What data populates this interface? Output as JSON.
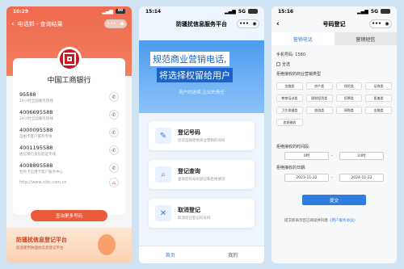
{
  "phone1": {
    "time": "10:29",
    "nav_title": "电话邦 - 查询结果",
    "bank_name": "中国工商银行",
    "numbers": [
      {
        "number": "95588",
        "desc": "24小时全国服务热线"
      },
      {
        "number": "4006695588",
        "desc": "24小时全国服务热线"
      },
      {
        "number": "4000095588",
        "desc": "自由卡客户服务专线"
      },
      {
        "number": "4001195588",
        "desc": "短信银行身份验证专线"
      },
      {
        "number": "4008895588",
        "desc": "牡丹卡信用卡客户服务中心"
      }
    ],
    "url": "http://www.icbc.com.cn",
    "more_button": "查询更多号码",
    "banner_title": "防骚扰信息登记平台",
    "banner_sub": "欢迎使用防骚扰信息登记平台"
  },
  "phone2": {
    "time": "15:14",
    "signal": "5G",
    "nav_title": "防骚扰信息服务平台",
    "hero_line1": "规范商业营销电话,",
    "hero_line2": "将选择权留给用户",
    "hero_sub": "用户的选择,企业的责任",
    "items": [
      {
        "title": "登记号码",
        "desc": "您可选择拒绝商业营销的号码"
      },
      {
        "title": "登记查询",
        "desc": "查询您的号码登记和拒绝情况"
      },
      {
        "title": "取消登记",
        "desc": "取消您已登记的号码"
      }
    ],
    "tab_home": "首页",
    "tab_mine": "我的"
  },
  "phone3": {
    "time": "15:16",
    "signal": "5G",
    "nav_title": "号码登记",
    "tab_call": "营销电话",
    "tab_sms": "营销短信",
    "phone_label": "手机号码:",
    "phone_value": "1580",
    "select_all": "全选",
    "reject_types_label": "拒绝接收的商业营销类型",
    "types": [
      "金融类",
      "房产类",
      "保险类",
      "证券类",
      "教育培训类",
      "理财投资类",
      "招聘类",
      "医美类",
      "卫生保健类",
      "旅游类",
      "网购类",
      "金融类",
      "违规催收"
    ],
    "reject_time_label": "拒绝接收的时间段:",
    "time_from": "0时",
    "time_to": "24时",
    "reject_date_label": "拒绝接收的日期:",
    "date_from": "2023-11-22",
    "date_to": "2024-11-22",
    "submit": "提交",
    "agree_text": "提交即表示您已阅读并同意",
    "agree_link": "《用户服务协议》"
  }
}
